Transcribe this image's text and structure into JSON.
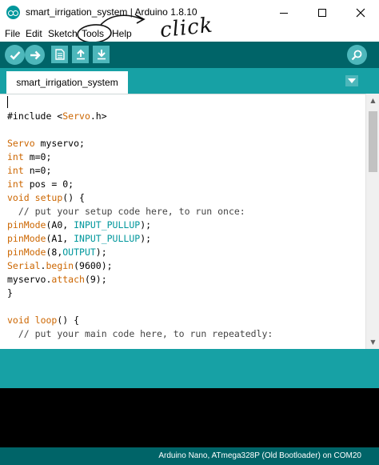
{
  "window": {
    "title": "smart_irrigation_system | Arduino 1.8.10"
  },
  "menu": {
    "items": [
      "File",
      "Edit",
      "Sketch",
      "Tools",
      "Help"
    ]
  },
  "annotation": {
    "text": "click"
  },
  "toolbar": {
    "buttons": [
      "verify-icon",
      "upload-icon",
      "new-icon",
      "open-icon",
      "save-icon"
    ],
    "serial_monitor": "magnifier-icon"
  },
  "tabs": {
    "active": "smart_irrigation_system"
  },
  "editor": {
    "lines": [
      "",
      "#include <Servo.h>",
      "",
      "Servo myservo;",
      "int m=0;",
      "int n=0;",
      "int pos = 0;",
      "void setup() {",
      "  // put your setup code here, to run once:",
      "pinMode(A0, INPUT_PULLUP);",
      "pinMode(A1, INPUT_PULLUP);",
      "pinMode(8,OUTPUT);",
      "Serial.begin(9600);",
      "myservo.attach(9);",
      "}",
      "",
      "void loop() {",
      "  // put your main code here, to run repeatedly:"
    ]
  },
  "status": {
    "board": "Arduino Nano, ATmega328P (Old Bootloader) on COM20"
  },
  "colors": {
    "toolbar": "#006468",
    "tabbar": "#17a1a5",
    "button": "#4db7bb",
    "keyword": "#cc6600",
    "constant": "#00979c",
    "console": "#000000"
  }
}
